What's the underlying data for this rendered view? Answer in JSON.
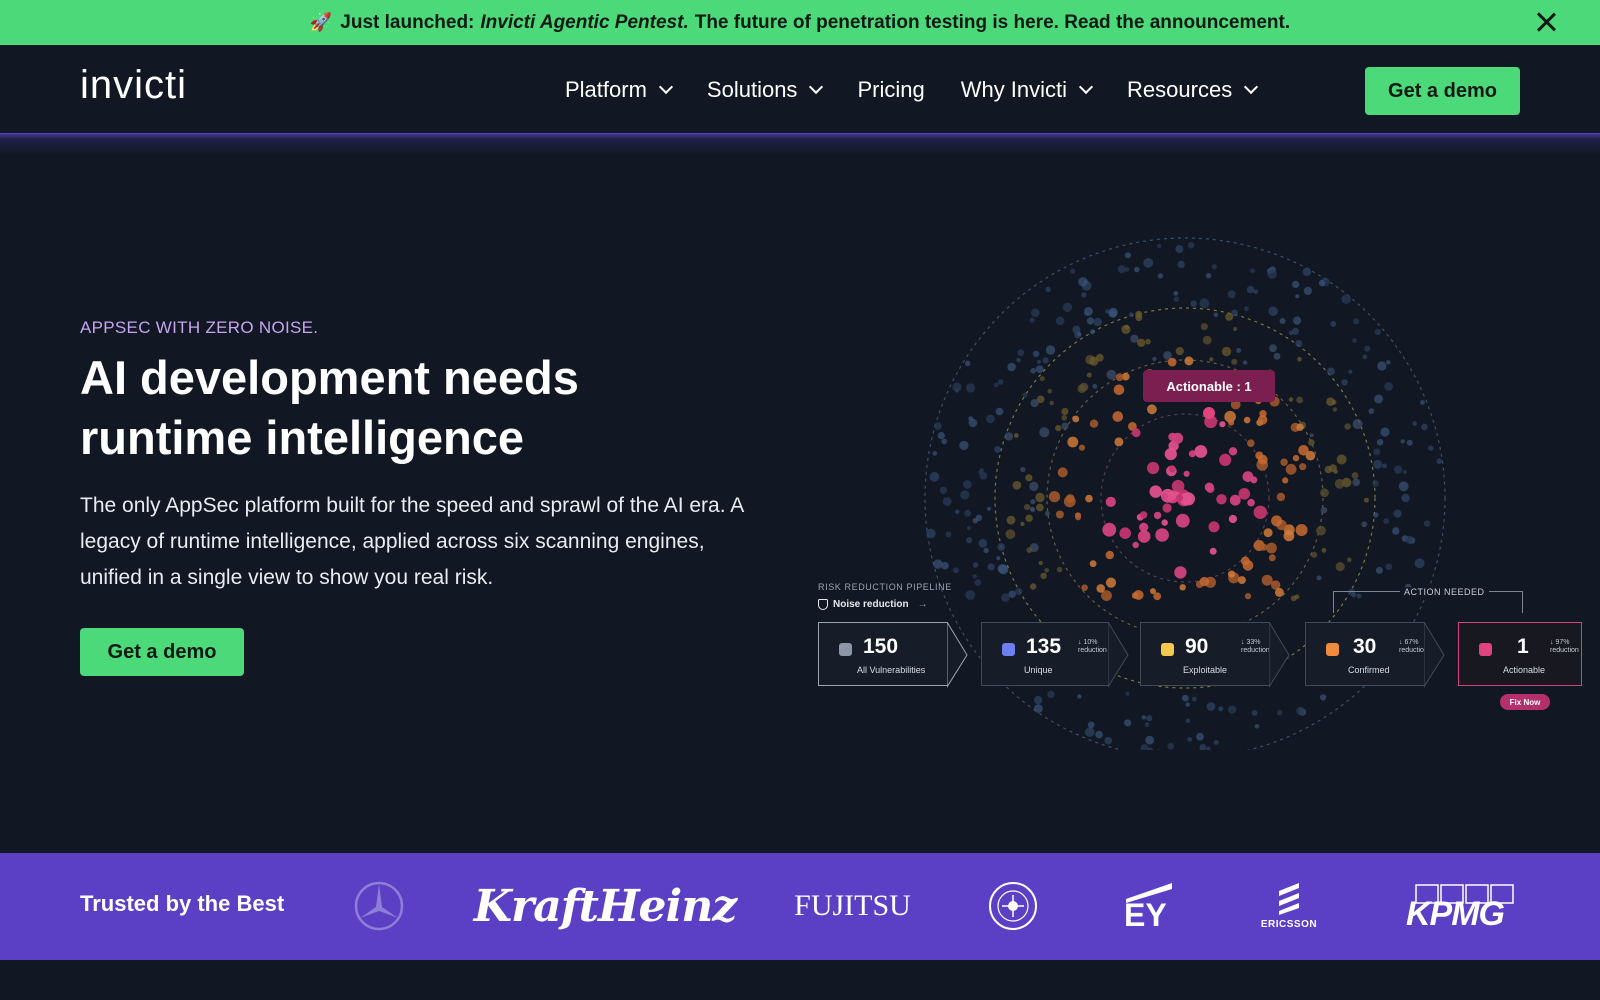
{
  "announcement": {
    "icon": "rocket-icon",
    "lead": "Just launched:",
    "product": "Invicti Agentic Pentest.",
    "rest": "The future of penetration testing is here. Read the announcement."
  },
  "nav": {
    "logo": "invicti",
    "items": [
      {
        "label": "Platform",
        "dropdown": true
      },
      {
        "label": "Solutions",
        "dropdown": true
      },
      {
        "label": "Pricing",
        "dropdown": false
      },
      {
        "label": "Why Invicti",
        "dropdown": true
      },
      {
        "label": "Resources",
        "dropdown": true
      }
    ],
    "cta": "Get a demo"
  },
  "hero": {
    "eyebrow": "APPSEC WITH ZERO NOISE.",
    "title_line1": "AI development needs",
    "title_line2": "runtime intelligence",
    "description": "The only AppSec platform built for the speed and sprawl of the AI era. A legacy of runtime intelligence, applied across six scanning engines, unified in a single view to show you real risk.",
    "cta": "Get a demo"
  },
  "visual": {
    "actionable_pill": "Actionable : 1",
    "pipeline_label": "RISK REDUCTION PIPELINE",
    "noise_label": "Noise reduction",
    "action_needed": "ACTION NEEDED",
    "fix_now": "Fix Now",
    "cards": [
      {
        "value": "150",
        "label": "All Vulnerabilities",
        "reduction": "",
        "color": "#8d96a6"
      },
      {
        "value": "135",
        "label": "Unique",
        "reduction": "↓ 10%",
        "color": "#6e7ff0"
      },
      {
        "value": "90",
        "label": "Exploitable",
        "reduction": "↓ 33%",
        "color": "#f2c94c"
      },
      {
        "value": "30",
        "label": "Confirmed",
        "reduction": "↓ 67%",
        "color": "#f08a3c"
      },
      {
        "value": "1",
        "label": "Actionable",
        "reduction": "↓ 97%",
        "color": "#e0447f"
      }
    ],
    "reduction_word": "reduction"
  },
  "trusted": {
    "title": "Trusted by the Best",
    "logos": [
      "mercedes-benz-logo",
      "KraftHeinz",
      "FUJITSU",
      "faa-seal-logo",
      "EY",
      "ERICSSON",
      "KPMG"
    ]
  },
  "colors": {
    "accent_green": "#4cd97a",
    "background": "#111823",
    "brand_purple": "#5b3fc4",
    "eyebrow_lavender": "#c8a3f0",
    "actionable_magenta": "#7a1f4f"
  }
}
